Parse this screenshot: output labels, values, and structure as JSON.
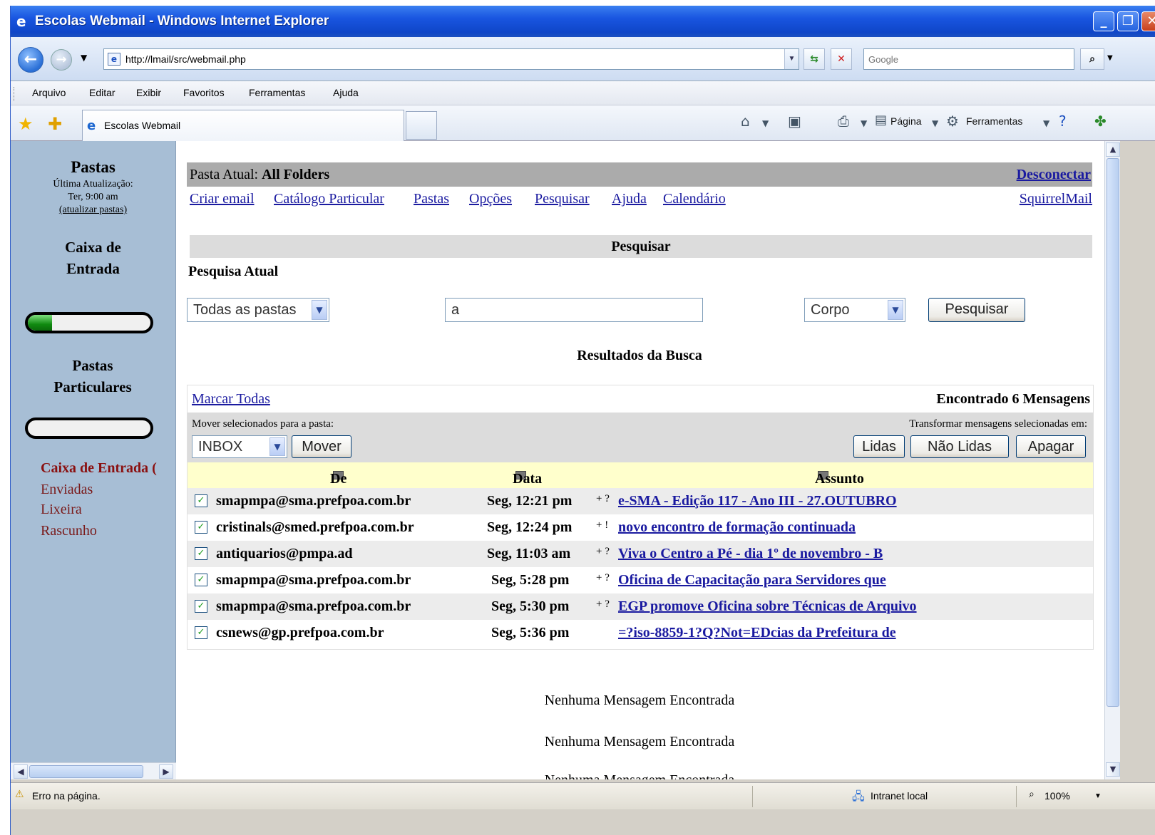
{
  "browser": {
    "title": "Escolas Webmail - Windows Internet Explorer",
    "url": "http://lmail/src/webmail.php",
    "search_placeholder": "Google",
    "menu": [
      "Arquivo",
      "Editar",
      "Exibir",
      "Favoritos",
      "Ferramentas",
      "Ajuda"
    ],
    "tab_title": "Escolas Webmail",
    "toolbar": {
      "page_label": "Página",
      "tools_label": "Ferramentas"
    },
    "status": {
      "message": "Erro na página.",
      "zone": "Intranet local",
      "zoom": "100%"
    }
  },
  "sidebar": {
    "title": "Pastas",
    "last_update_label": "Última Atualização:",
    "last_update_time": "Ter, 9:00 am",
    "refresh_link": "(atualizar pastas)",
    "inbox_section": "Caixa de Entrada",
    "inbox_quota": 0.2,
    "personal_section": "Pastas Particulares",
    "personal_quota": 0,
    "folders": [
      "Caixa de Entrada (",
      "Enviadas",
      "Lixeira",
      "Rascunho"
    ]
  },
  "header": {
    "current_folder_label": "Pasta Atual:",
    "current_folder": "All Folders",
    "logout": "Desconectar",
    "nav": [
      "Criar email",
      "Catálogo Particular",
      "Pastas",
      "Opções",
      "Pesquisar",
      "Ajuda",
      "Calendário"
    ],
    "brand_link": "SquirrelMail"
  },
  "search": {
    "title": "Pesquisar",
    "current_label": "Pesquisa Atual",
    "scope": "Todas as pastas",
    "query": "a",
    "field": "Corpo",
    "button": "Pesquisar",
    "results_title": "Resultados da Busca"
  },
  "results": {
    "mark_all": "Marcar Todas",
    "found": "Encontrado 6 Mensagens",
    "move_label": "Mover selecionados para a pasta:",
    "move_target": "INBOX",
    "move_button": "Mover",
    "transform_label": "Transformar mensagens selecionadas em:",
    "btn_read": "Lidas",
    "btn_unread": "Não Lidas",
    "btn_delete": "Apagar",
    "columns": {
      "from": "De",
      "date": "Data",
      "subject": "Assunto"
    },
    "rows": [
      {
        "from": "smapmpa@sma.prefpoa.com.br",
        "date": "Seg, 12:21 pm",
        "flag": "+ ?",
        "subject": "e-SMA - Edição 117 - Ano III - 27.OUTUBRO"
      },
      {
        "from": "cristinals@smed.prefpoa.com.br",
        "date": "Seg, 12:24 pm",
        "flag": "+ !",
        "subject": "novo encontro de formação continuada"
      },
      {
        "from": "antiquarios@pmpa.ad",
        "date": "Seg, 11:03 am",
        "flag": "+ ?",
        "subject": "Viva o Centro a Pé - dia 1º de novembro - B"
      },
      {
        "from": "smapmpa@sma.prefpoa.com.br",
        "date": "Seg, 5:28 pm",
        "flag": "+ ?",
        "subject": "Oficina de Capacitação para Servidores que"
      },
      {
        "from": "smapmpa@sma.prefpoa.com.br",
        "date": "Seg, 5:30 pm",
        "flag": "+ ?",
        "subject": "EGP promove Oficina sobre Técnicas de Arquivo"
      },
      {
        "from": "csnews@gp.prefpoa.com.br",
        "date": "Seg, 5:36 pm",
        "flag": "",
        "subject": "=?iso-8859-1?Q?Not=EDcias da Prefeitura de"
      }
    ],
    "none_found": [
      "Nenhuma Mensagem Encontrada",
      "Nenhuma Mensagem Encontrada",
      "Nenhuma Mensagem Encontrada"
    ]
  }
}
